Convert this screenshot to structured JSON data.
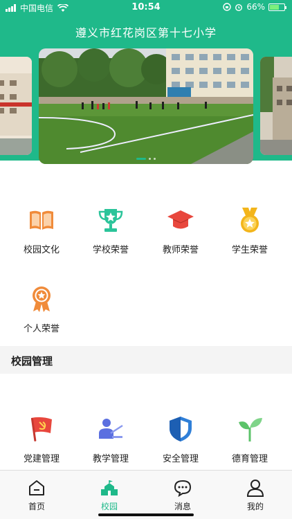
{
  "status_bar": {
    "carrier": "中国电信",
    "time": "10:54",
    "battery": "66%",
    "battery_level": 0.66
  },
  "header": {
    "title": "遵义市红花岗区第十七小学"
  },
  "banner": {
    "slide_count": 3,
    "active_slide": 1
  },
  "honors": {
    "items": [
      {
        "label": "校园文化",
        "icon": "book-icon",
        "color": "#f08b3a"
      },
      {
        "label": "学校荣誉",
        "icon": "trophy-icon",
        "color": "#2bc49a"
      },
      {
        "label": "教师荣誉",
        "icon": "graduation-cap-icon",
        "color": "#e8473d"
      },
      {
        "label": "学生荣誉",
        "icon": "medal-icon",
        "color": "#f3b51b"
      },
      {
        "label": "个人荣誉",
        "icon": "rosette-icon",
        "color": "#f08b3a"
      }
    ]
  },
  "management": {
    "section_title": "校园管理",
    "items": [
      {
        "label": "党建管理",
        "icon": "party-flag-icon",
        "color": "#e8473d"
      },
      {
        "label": "教学管理",
        "icon": "teacher-icon",
        "color": "#5b6fe0"
      },
      {
        "label": "安全管理",
        "icon": "shield-icon",
        "color": "#2f7fd8"
      },
      {
        "label": "德育管理",
        "icon": "sprout-icon",
        "color": "#5cc36a"
      }
    ]
  },
  "tabbar": {
    "items": [
      {
        "label": "首页",
        "icon": "home-icon"
      },
      {
        "label": "校园",
        "icon": "school-icon",
        "active": true
      },
      {
        "label": "消息",
        "icon": "message-icon"
      },
      {
        "label": "我的",
        "icon": "profile-icon"
      }
    ],
    "active_color": "#1fb98a"
  },
  "colors": {
    "brand": "#1fb98a"
  }
}
